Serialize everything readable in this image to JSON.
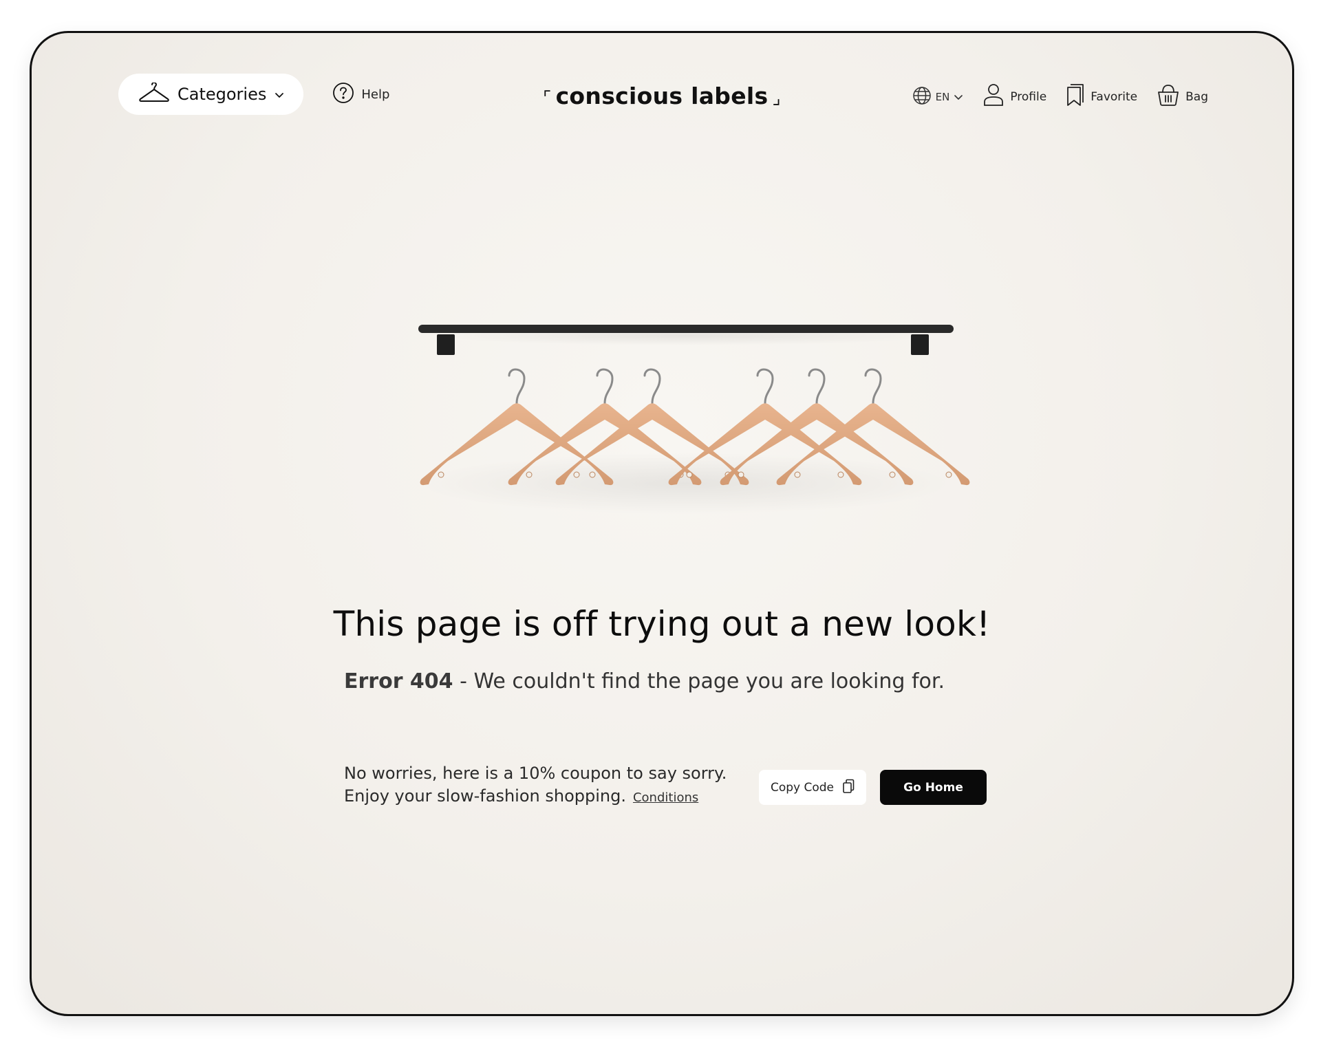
{
  "nav": {
    "categories_label": "Categories",
    "help_label": "Help",
    "logo_text": "conscious labels",
    "logo_open_bracket": "⌜",
    "logo_close_bracket": "⌟",
    "language": "EN",
    "profile_label": "Profile",
    "favorite_label": "Favorite",
    "bag_label": "Bag"
  },
  "error": {
    "headline": "This page is off trying out a new look!",
    "code": "Error 404",
    "separator": " - ",
    "message": "We couldn't find the page you are looking for."
  },
  "coupon": {
    "line1": "No worries, here is a 10% coupon to say sorry.",
    "line2": "Enjoy your slow-fashion shopping.",
    "conditions_label": "Conditions",
    "copy_label": "Copy Code",
    "home_label": "Go Home"
  },
  "colors": {
    "page_background": "#f4f1ec",
    "hanger_wood": "#dfa57d",
    "rail": "#2a2a2a",
    "primary_button": "#0a0a0a"
  },
  "icons": {
    "categories": "hanger-icon",
    "help": "question-circle-icon",
    "language": "globe-icon",
    "profile": "user-icon",
    "favorite": "bookmark-icon",
    "bag": "basket-icon",
    "copy": "copy-icon"
  }
}
